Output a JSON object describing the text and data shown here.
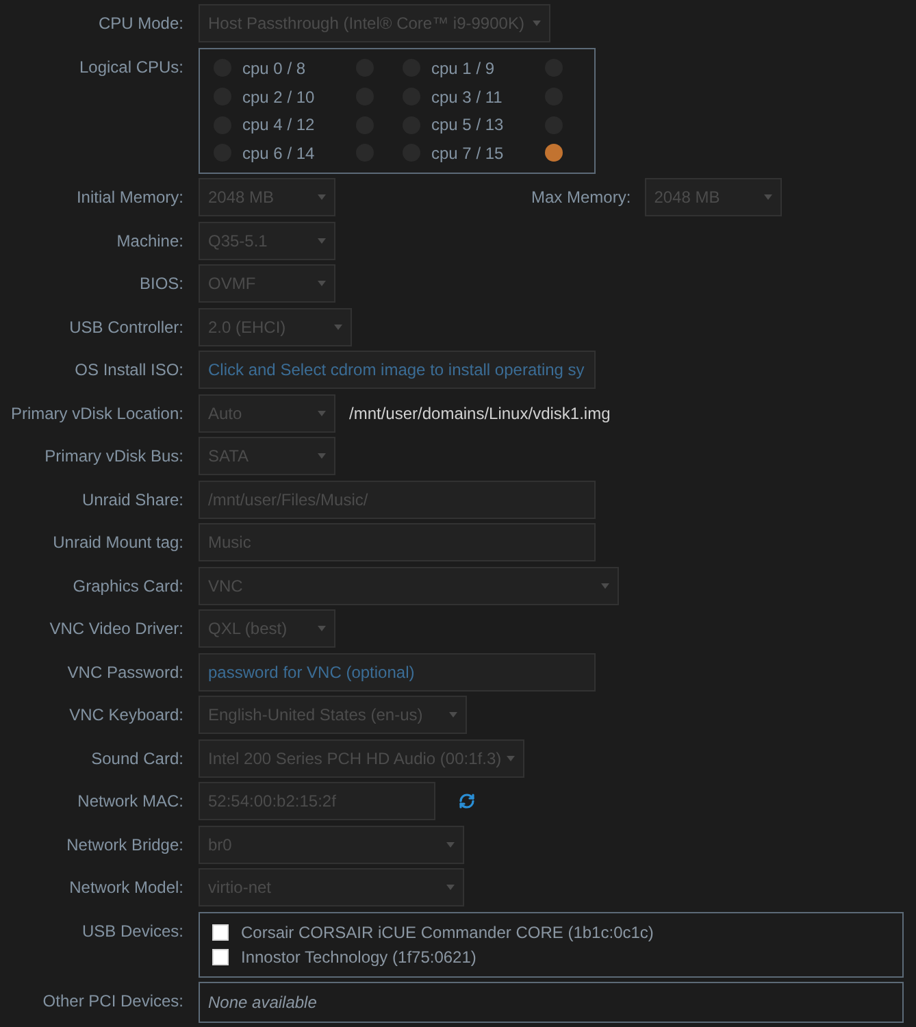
{
  "cpu_mode": {
    "label": "CPU Mode:",
    "value": "Host Passthrough (Intel® Core™ i9-9900K)"
  },
  "logical_cpus": {
    "label": "Logical CPUs:",
    "cpus": [
      {
        "label": "cpu 0 / 8",
        "threads": [
          {
            "checked": false
          },
          {
            "checked": false
          }
        ]
      },
      {
        "label": "cpu 1 / 9",
        "threads": [
          {
            "checked": false
          },
          {
            "checked": false
          }
        ]
      },
      {
        "label": "cpu 2 / 10",
        "threads": [
          {
            "checked": false
          },
          {
            "checked": false
          }
        ]
      },
      {
        "label": "cpu 3 / 11",
        "threads": [
          {
            "checked": false
          },
          {
            "checked": false
          }
        ]
      },
      {
        "label": "cpu 4 / 12",
        "threads": [
          {
            "checked": false
          },
          {
            "checked": false
          }
        ]
      },
      {
        "label": "cpu 5 / 13",
        "threads": [
          {
            "checked": false
          },
          {
            "checked": false
          }
        ]
      },
      {
        "label": "cpu 6 / 14",
        "threads": [
          {
            "checked": false
          },
          {
            "checked": false
          }
        ]
      },
      {
        "label": "cpu 7 / 15",
        "threads": [
          {
            "checked": false
          },
          {
            "checked": true
          }
        ]
      }
    ]
  },
  "initial_memory": {
    "label": "Initial Memory:",
    "value": "2048 MB"
  },
  "max_memory": {
    "label": "Max Memory:",
    "value": "2048 MB"
  },
  "machine": {
    "label": "Machine:",
    "value": "Q35-5.1"
  },
  "bios": {
    "label": "BIOS:",
    "value": "OVMF"
  },
  "usb_controller": {
    "label": "USB Controller:",
    "value": "2.0 (EHCI)"
  },
  "os_install_iso": {
    "label": "OS Install ISO:",
    "placeholder": "Click and Select cdrom image to install operating sy"
  },
  "primary_vdisk_location": {
    "label": "Primary vDisk Location:",
    "value": "Auto",
    "path": "/mnt/user/domains/Linux/vdisk1.img"
  },
  "primary_vdisk_bus": {
    "label": "Primary vDisk Bus:",
    "value": "SATA"
  },
  "unraid_share": {
    "label": "Unraid Share:",
    "value": "/mnt/user/Files/Music/"
  },
  "unraid_mount_tag": {
    "label": "Unraid Mount tag:",
    "value": "Music"
  },
  "graphics_card": {
    "label": "Graphics Card:",
    "value": "VNC"
  },
  "vnc_video_driver": {
    "label": "VNC Video Driver:",
    "value": "QXL (best)"
  },
  "vnc_password": {
    "label": "VNC Password:",
    "placeholder": "password for VNC (optional)"
  },
  "vnc_keyboard": {
    "label": "VNC Keyboard:",
    "value": "English-United States (en-us)"
  },
  "sound_card": {
    "label": "Sound Card:",
    "value": "Intel 200 Series PCH HD Audio (00:1f.3)"
  },
  "network_mac": {
    "label": "Network MAC:",
    "value": "52:54:00:b2:15:2f"
  },
  "network_bridge": {
    "label": "Network Bridge:",
    "value": "br0"
  },
  "network_model": {
    "label": "Network Model:",
    "value": "virtio-net"
  },
  "usb_devices": {
    "label": "USB Devices:",
    "devices": [
      {
        "label": "Corsair CORSAIR iCUE Commander CORE (1b1c:0c1c)",
        "checked": false
      },
      {
        "label": "Innostor Technology (1f75:0621)",
        "checked": false
      }
    ]
  },
  "other_pci_devices": {
    "label": "Other PCI Devices:",
    "message": "None available"
  }
}
